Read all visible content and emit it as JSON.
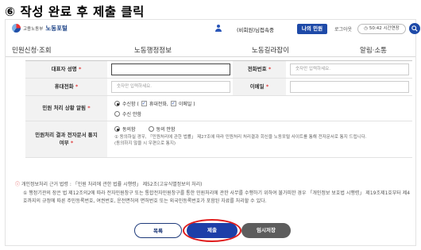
{
  "step_title": "⑥ 작성 완료 후 제출 클릭",
  "header": {
    "logo_small": "고용노동부",
    "logo_big": "노동포털",
    "user_name": "(비회원)님접속중",
    "my_button": "나의 민원",
    "logout": "로그아웃",
    "timer": "50:42 시간연장"
  },
  "nav": [
    "민원신청·조회",
    "노동행정정보",
    "노동길라잡이",
    "알림·소통"
  ],
  "form": {
    "rep_name_label": "대표자 성명",
    "phone_label": "전화번호",
    "phone_placeholder": "숫자만 입력하세요.",
    "mobile_label": "휴대전화",
    "mobile_placeholder": "숫자만 입력하세요.",
    "email_label": "이메일",
    "required_mark": "*",
    "alert_label": "민원 처리 상황 알림",
    "alert_opt1_prefix": "수신함 (",
    "alert_opt1_mobile": "휴대전화,",
    "alert_opt1_email": "이메일 )",
    "alert_opt2": "수신 안함",
    "consent_label_line1": "민원처리 결과 전자문서 통지",
    "consent_label_line2": "여부",
    "consent_yes": "동의함",
    "consent_no": "동의 안함",
    "consent_note1": "① 동의하실 경우, 「민원처리에 관한 법률」 제27조에 따라 민원처리 처리결과 회신을 노동포털 사이트를 통해 전자문서로 통지 드립니다.",
    "consent_note2": "(동의하지 않을 시 우편으로 통지)"
  },
  "notice": {
    "line1": "개인정보처리 근거 법령 : 「민원 처리에 관한 법률 시행령」 제52조(고유식별정보의 처리)",
    "line2": "① 행정기관의 장은 법 제12조의2에 따라 전자민원창구 또는 통합전자민원창구를 통한 민원처리에 관한 사무를 수행하기 위하여 불가피한 경우 「개인정보 보호법 시행령」 제19조제1호부터 제4호까지의 규정에 따른 주민등록번호, 여권번호, 운전면허의 면허번호 또는 외국인등록번호가 포함된 자료를 처리할 수 있다."
  },
  "buttons": {
    "list": "목록",
    "submit": "제출",
    "temp_save": "임시저장"
  },
  "colors": {
    "brand_blue": "#1e4aa8",
    "highlight_red": "#e01c1c",
    "required_red": "#e03a3a"
  }
}
